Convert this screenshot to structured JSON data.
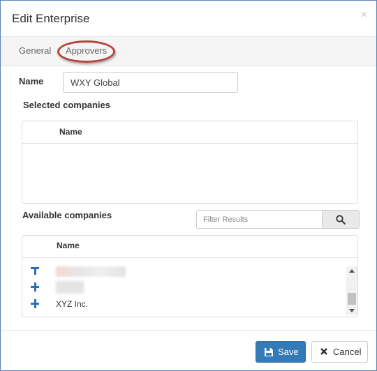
{
  "dialog": {
    "title": "Edit Enterprise",
    "close_icon": "×"
  },
  "tabs": [
    {
      "label": "General"
    },
    {
      "label": "Approvers"
    }
  ],
  "form": {
    "name_label": "Name",
    "name_value": "WXY Global"
  },
  "selected_companies": {
    "label": "Selected companies",
    "column_header": "Name",
    "rows": []
  },
  "available_companies": {
    "label": "Available companies",
    "filter_placeholder": "Filter Results",
    "column_header": "Name",
    "rows": [
      {
        "name": "",
        "icon": "plus-icon"
      },
      {
        "name": "",
        "icon": "plus-icon"
      },
      {
        "name": "XYZ Inc.",
        "icon": "plus-icon"
      }
    ]
  },
  "footer": {
    "save_label": "Save",
    "cancel_label": "Cancel"
  },
  "colors": {
    "primary": "#337ab7",
    "accent_ring": "#b5453f",
    "border": "#5a84b9"
  }
}
